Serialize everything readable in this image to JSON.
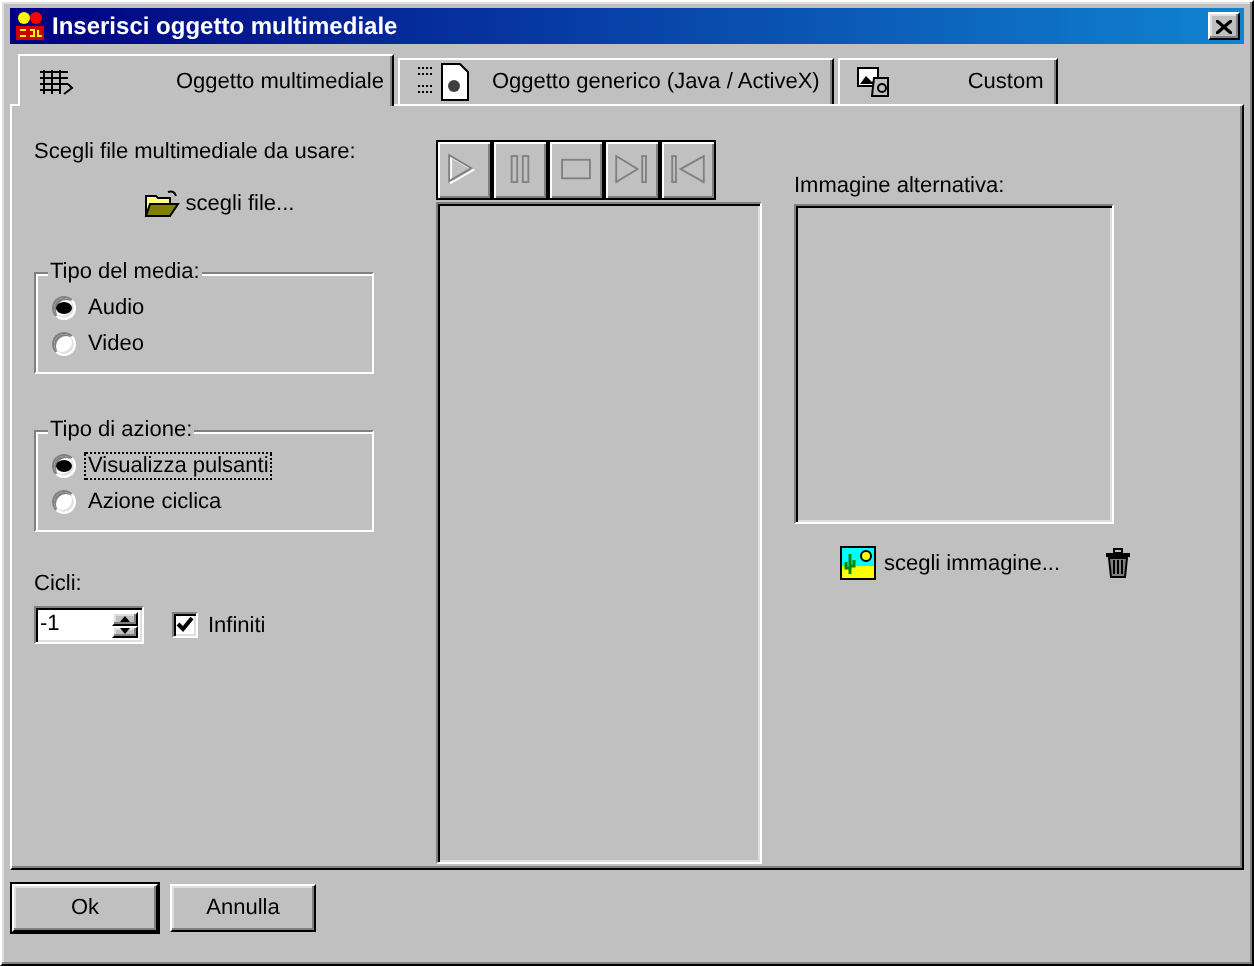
{
  "window": {
    "title": "Inserisci oggetto multimediale"
  },
  "tabs": [
    {
      "label": "Oggetto multimediale",
      "selected": true
    },
    {
      "label": "Oggetto generico (Java / ActiveX)",
      "selected": false
    },
    {
      "label": "Custom",
      "selected": false
    }
  ],
  "file_prompt": "Scegli file multimediale da usare:",
  "choose_file_button": "scegli file...",
  "media_type": {
    "legend": "Tipo del media:",
    "options": [
      {
        "label": "Audio",
        "selected": true,
        "focused": false
      },
      {
        "label": "Video",
        "selected": false,
        "focused": false
      }
    ]
  },
  "action_type": {
    "legend": "Tipo di azione:",
    "options": [
      {
        "label": "Visualizza pulsanti",
        "selected": true,
        "focused": true
      },
      {
        "label": "Azione ciclica",
        "selected": false,
        "focused": false
      }
    ]
  },
  "cycles": {
    "label": "Cicli:",
    "value": "-1",
    "infinite": {
      "label": "Infiniti",
      "checked": true
    }
  },
  "player_controls": [
    {
      "kind": "play",
      "disabled": true
    },
    {
      "kind": "pause",
      "disabled": true
    },
    {
      "kind": "stop",
      "disabled": true
    },
    {
      "kind": "next",
      "disabled": true
    },
    {
      "kind": "previous",
      "disabled": true
    }
  ],
  "alt_image": {
    "label": "Immagine alternativa:",
    "choose_button": "scegli immagine..."
  },
  "buttons": [
    {
      "label": "Ok",
      "default": true
    },
    {
      "label": "Annulla",
      "default": false
    }
  ]
}
